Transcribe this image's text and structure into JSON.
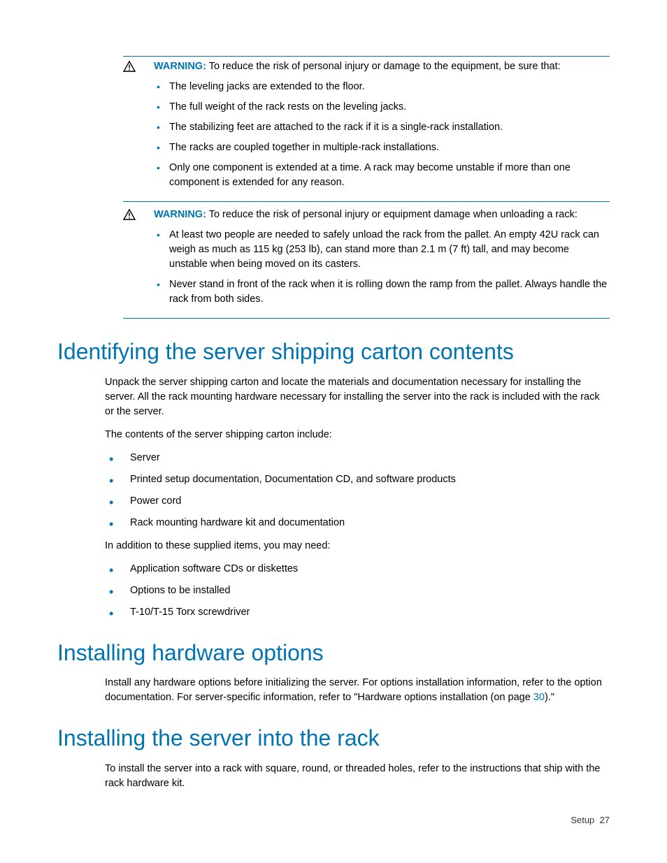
{
  "warnings": [
    {
      "label": "WARNING:",
      "intro": "To reduce the risk of personal injury or damage to the equipment, be sure that:",
      "items": [
        "The leveling jacks are extended to the floor.",
        "The full weight of the rack rests on the leveling jacks.",
        "The stabilizing feet are attached to the rack if it is a single-rack installation.",
        "The racks are coupled together in multiple-rack installations.",
        "Only one component is extended at a time. A rack may become unstable if more than one component is extended for any reason."
      ]
    },
    {
      "label": "WARNING:",
      "intro": "To reduce the risk of personal injury or equipment damage when unloading a rack:",
      "items": [
        "At least two people are needed to safely unload the rack from the pallet. An empty 42U rack can weigh as much as 115 kg (253 lb), can stand more than 2.1 m (7 ft) tall, and may become unstable when being moved on its casters.",
        "Never stand in front of the rack when it is rolling down the ramp from the pallet. Always handle the rack from both sides."
      ]
    }
  ],
  "sections": [
    {
      "heading": "Identifying the server shipping carton contents",
      "paras": [
        "Unpack the server shipping carton and locate the materials and documentation necessary for installing the server. All the rack mounting hardware necessary for installing the server into the rack is included with the rack or the server.",
        "The contents of the server shipping carton include:"
      ],
      "list1": [
        "Server",
        "Printed setup documentation, Documentation CD, and software products",
        "Power cord",
        "Rack mounting hardware kit and documentation"
      ],
      "mid": "In addition to these supplied items, you may need:",
      "list2": [
        "Application software CDs or diskettes",
        "Options to be installed",
        "T-10/T-15 Torx screwdriver"
      ]
    },
    {
      "heading": "Installing hardware options",
      "para_pre": "Install any hardware options before initializing the server. For options installation information, refer to the option documentation. For server-specific information, refer to \"Hardware options installation (on page ",
      "page_link": "30",
      "para_post": ").\""
    },
    {
      "heading": "Installing the server into the rack",
      "para": "To install the server into a rack with square, round, or threaded holes, refer to the instructions that ship with the rack hardware kit."
    }
  ],
  "footer": {
    "section": "Setup",
    "page": "27"
  }
}
